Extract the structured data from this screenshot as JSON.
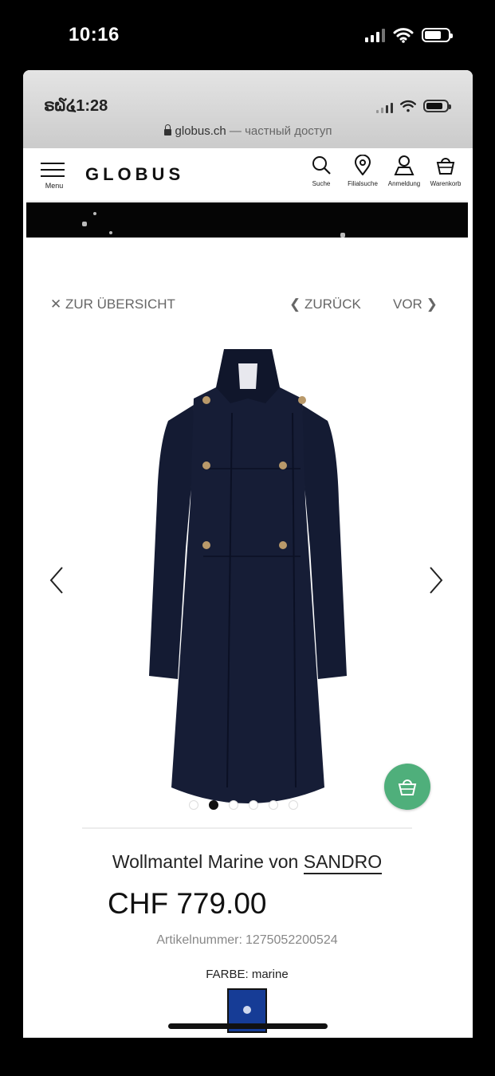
{
  "outer_status": {
    "time": "10:16"
  },
  "inner_status": {
    "time": "ຣ໖໔1:28"
  },
  "url_bar": {
    "domain": "globus.ch",
    "separator": "—",
    "subtitle": "частный доступ"
  },
  "header": {
    "menu_label": "Menu",
    "logo": "GLOBUS",
    "actions": [
      {
        "label": "Suche",
        "icon": "search-icon"
      },
      {
        "label": "Filialsuche",
        "icon": "location-pin-icon"
      },
      {
        "label": "Anmeldung",
        "icon": "user-icon"
      },
      {
        "label": "Warenkorb",
        "icon": "basket-icon"
      }
    ]
  },
  "nav": {
    "overview": "ZUR ÜBERSICHT",
    "back": "ZURÜCK",
    "next": "VOR"
  },
  "gallery": {
    "image_count": 6,
    "active_index": 1
  },
  "product": {
    "name": "Wollmantel Marine von",
    "brand": "SANDRO",
    "price": "CHF 779.00",
    "article_label": "Artikelnummer:",
    "article_number": "1275052200524",
    "color_label": "FARBE:",
    "color_value": "marine",
    "swatch_color": "#163c96"
  },
  "colors": {
    "cart_fab": "#4faf7b",
    "coat": "#141b33"
  }
}
